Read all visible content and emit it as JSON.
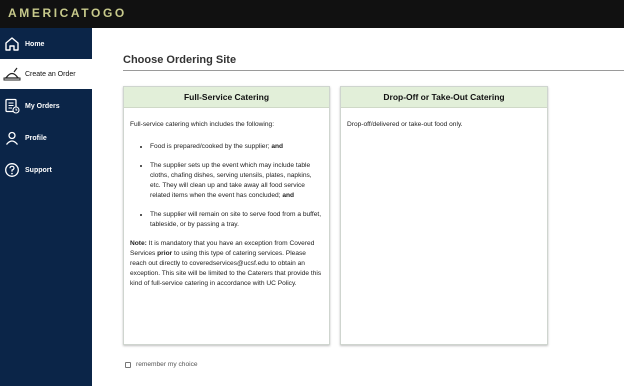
{
  "brand": "AMERICATOGO",
  "sidebar": {
    "items": [
      {
        "label": "Home",
        "icon": "home-icon"
      },
      {
        "label": "Create an Order",
        "icon": "food-tray-icon"
      },
      {
        "label": "My Orders",
        "icon": "orders-list-icon"
      },
      {
        "label": "Profile",
        "icon": "user-icon"
      },
      {
        "label": "Support",
        "icon": "help-circle-icon"
      }
    ]
  },
  "main": {
    "title": "Choose Ordering Site",
    "full_service": {
      "heading": "Full-Service Catering",
      "intro": "Full-service catering which includes the following:",
      "bullet1": "Food is prepared/cooked by the supplier;",
      "bullet1_strong": "and",
      "bullet2": "The supplier sets up the event which may include table cloths, chafing dishes, serving utensils, plates, napkins, etc. They will clean up and take away all food service related items when the event has concluded;",
      "bullet2_strong": "and",
      "bullet3": "The supplier will remain on site to serve food from a buffet, tableside, or by passing a tray.",
      "note_label": "Note:",
      "note_part1": "It is mandatory that you have an exception from Covered Services",
      "note_strong": "prior",
      "note_part2": "to using this type of catering services. Please reach out directly to coveredservices@ucsf.edu to obtain an exception. This site will be limited to the Caterers that provide this kind of full-service catering in accordance with UC Policy."
    },
    "dropoff": {
      "heading": "Drop-Off or Take-Out Catering",
      "body": "Drop-off/delivered or take-out food only."
    },
    "remember_label": "remember my choice",
    "remember_checked": false
  },
  "colors": {
    "topbar": "#111111",
    "sidebar": "#0b2548",
    "brand": "#c7c98b",
    "card_header": "#e2efd9"
  }
}
